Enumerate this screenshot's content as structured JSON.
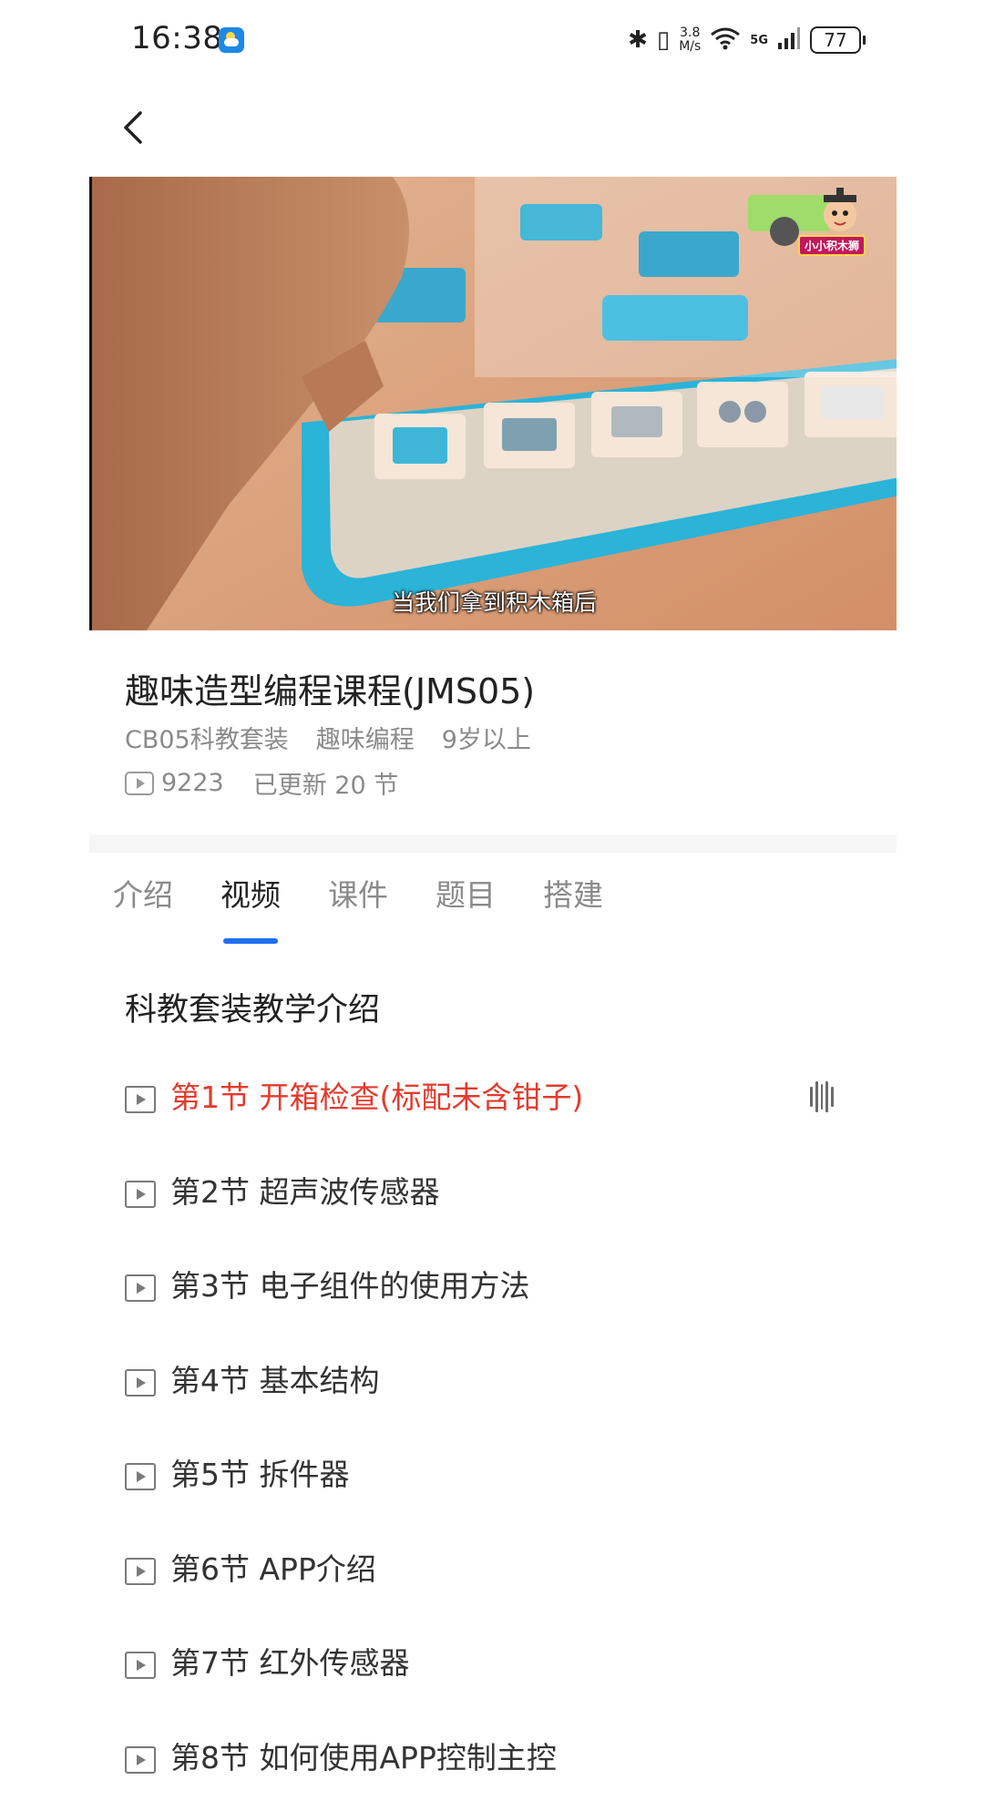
{
  "status_bar": {
    "time": "16:38",
    "net_speed_value": "3.8",
    "net_speed_unit": "M/s",
    "network": "5G",
    "battery": "77"
  },
  "video": {
    "subtitle": "当我们拿到积木箱后",
    "logo_text": "小小积木狮"
  },
  "course": {
    "title": "趣味造型编程课程(JMS05)",
    "tags": [
      "CB05科教套装",
      "趣味编程",
      "9岁以上"
    ],
    "play_count": "9223",
    "updated": "已更新 20 节"
  },
  "tabs": [
    {
      "label": "介绍",
      "active": false
    },
    {
      "label": "视频",
      "active": true
    },
    {
      "label": "课件",
      "active": false
    },
    {
      "label": "题目",
      "active": false
    },
    {
      "label": "搭建",
      "active": false
    }
  ],
  "section": {
    "title": "科教套装教学介绍"
  },
  "lessons": [
    {
      "label": "第1节 开箱检查(标配未含钳子)",
      "playing": true
    },
    {
      "label": "第2节 超声波传感器",
      "playing": false
    },
    {
      "label": "第3节 电子组件的使用方法",
      "playing": false
    },
    {
      "label": "第4节 基本结构",
      "playing": false
    },
    {
      "label": "第5节 拆件器",
      "playing": false
    },
    {
      "label": "第6节 APP介绍",
      "playing": false
    },
    {
      "label": "第7节 红外传感器",
      "playing": false
    },
    {
      "label": "第8节 如何使用APP控制主控",
      "playing": false
    }
  ],
  "colors": {
    "accent": "#1e6ff0",
    "playing": "#e23b2e"
  }
}
